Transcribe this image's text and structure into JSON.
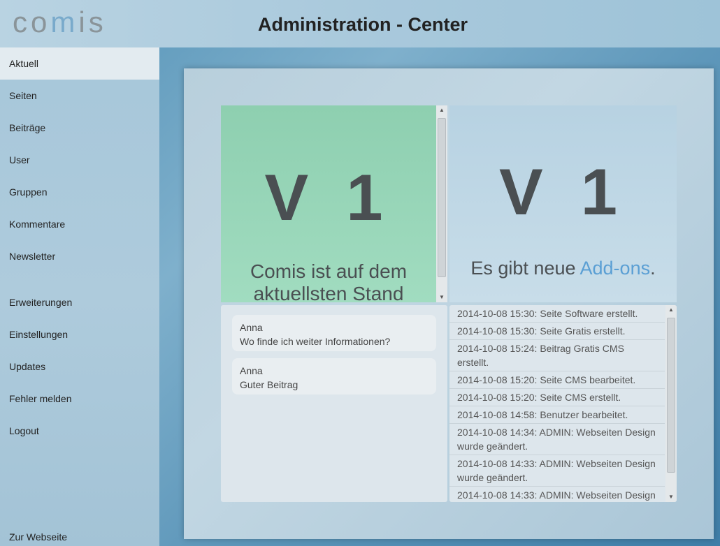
{
  "header": {
    "logo": "comis",
    "title": "Administration - Center"
  },
  "sidebar": {
    "items": [
      {
        "label": "Aktuell",
        "active": true
      },
      {
        "label": "Seiten"
      },
      {
        "label": "Beiträge"
      },
      {
        "label": "User"
      },
      {
        "label": "Gruppen"
      },
      {
        "label": "Kommentare"
      },
      {
        "label": "Newsletter"
      },
      {
        "label": "Erweiterungen"
      },
      {
        "label": "Einstellungen"
      },
      {
        "label": "Updates"
      },
      {
        "label": "Fehler melden"
      },
      {
        "label": "Logout"
      },
      {
        "label": "Zur Webseite"
      }
    ]
  },
  "version_tile": {
    "version": "V 1",
    "message": "Comis ist auf dem aktuellsten Stand",
    "color": "#98d6b8"
  },
  "addon_tile": {
    "version": "V 1",
    "message_prefix": "Es gibt neue ",
    "link": "Add-ons",
    "message_suffix": ".",
    "link_color": "#5a9fd4"
  },
  "comments": [
    {
      "author": "Anna",
      "text": "Wo finde ich weiter Informationen?"
    },
    {
      "author": "Anna",
      "text": "Guter Beitrag"
    }
  ],
  "log": [
    "2014-10-08 15:30: Seite Software erstellt.",
    "2014-10-08 15:30: Seite Gratis erstellt.",
    "2014-10-08 15:24: Beitrag Gratis CMS erstellt.",
    "2014-10-08 15:20: Seite CMS bearbeitet.",
    "2014-10-08 15:20: Seite CMS erstellt.",
    "2014-10-08 14:58: Benutzer bearbeitet.",
    "2014-10-08 14:34: ADMIN: Webseiten Design wurde geändert.",
    "2014-10-08 14:33: ADMIN: Webseiten Design wurde geändert.",
    "2014-10-08 14:33: ADMIN: Webseiten Design"
  ],
  "icons": {
    "scroll_up": "scroll-up-arrow-icon",
    "scroll_down": "scroll-down-arrow-icon"
  }
}
